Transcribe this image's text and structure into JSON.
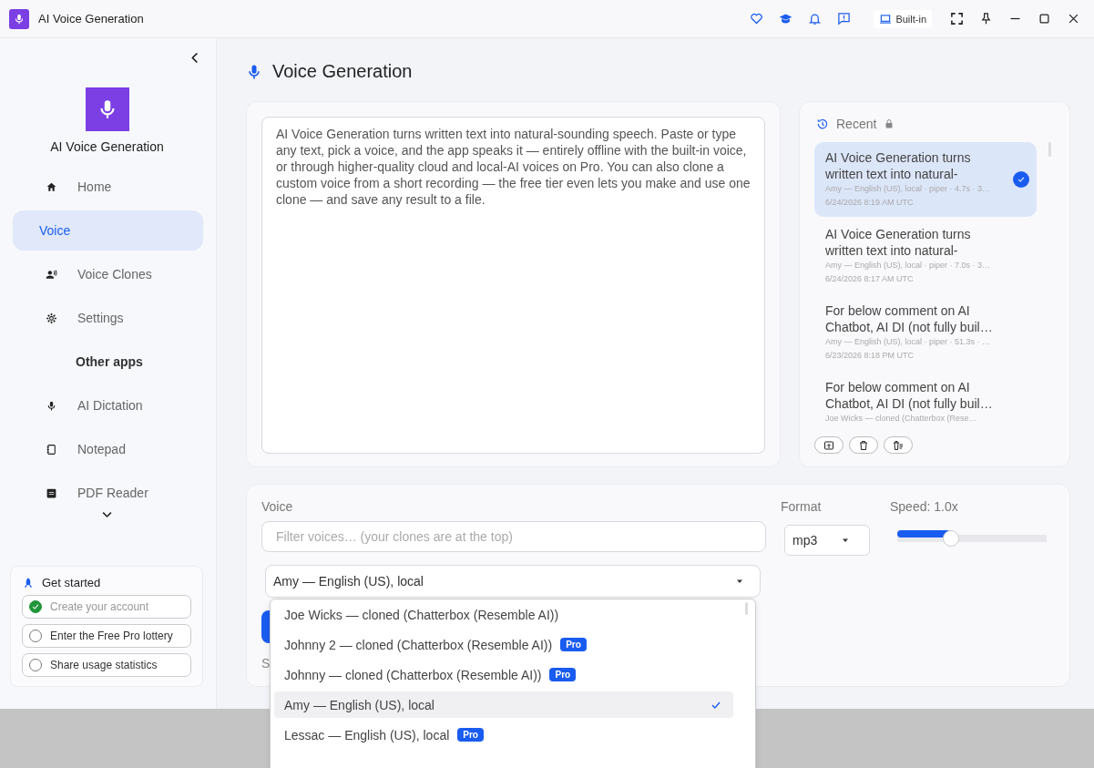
{
  "window": {
    "title": "AI Voice Generation",
    "badge": "Built-in"
  },
  "sidebar": {
    "app_name": "AI Voice Generation",
    "items": [
      {
        "kind": "item",
        "label": "Home",
        "selected": false
      },
      {
        "kind": "item",
        "label": "Voice",
        "selected": true
      },
      {
        "kind": "item",
        "label": "Voice Clones",
        "selected": false
      },
      {
        "kind": "item",
        "label": "Settings",
        "selected": false
      },
      {
        "kind": "header",
        "label": "Other apps"
      },
      {
        "kind": "item",
        "label": "AI Dictation",
        "selected": false
      },
      {
        "kind": "item",
        "label": "Notepad",
        "selected": false
      },
      {
        "kind": "item",
        "label": "PDF Reader",
        "selected": false
      }
    ],
    "get_started": {
      "title": "Get started",
      "tasks": [
        {
          "label": "Create your account",
          "checked": true
        },
        {
          "label": "Enter the Free Pro lottery",
          "checked": false
        },
        {
          "label": "Share usage statistics",
          "checked": false
        }
      ]
    }
  },
  "page": {
    "title": "Voice Generation",
    "text": "AI Voice Generation turns written text into natural-sounding speech. Paste or type any text, pick a voice, and the app speaks it — entirely offline with the built-in voice, or through higher-quality cloud and local-AI voices on Pro. You can also clone a custom voice from a short recording — the free tier even lets you make and use one clone — and save any result to a file.",
    "recent": {
      "title": "Recent",
      "items": [
        {
          "title": "AI Voice Generation turns written text into natural-",
          "meta": "Amy — English (US), local · piper · 4.7s · 3…",
          "date": "6/24/2026 8:19 AM UTC",
          "selected": true
        },
        {
          "title": "AI Voice Generation turns written text into natural-",
          "meta": "Amy — English (US), local · piper · 7.0s · 3…",
          "date": "6/24/2026 8:17 AM UTC",
          "selected": false
        },
        {
          "title": "For below comment on AI Chatbot, AI DI (not fully buil…",
          "meta": "Amy — English (US), local · piper · 51.3s · …",
          "date": "6/23/2026 8:18 PM UTC",
          "selected": false
        },
        {
          "title": "For below comment on AI Chatbot, AI DI (not fully buil…",
          "meta": "Joe Wicks — cloned (Chatterbox (Rese…",
          "selected": false
        }
      ]
    },
    "voice": {
      "label": "Voice",
      "filter_placeholder": "Filter voices… (your clones are at the top)",
      "value": "Amy — English (US), local",
      "options": [
        {
          "label": "Joe Wicks — cloned (Chatterbox (Resemble AI))",
          "selected": false
        },
        {
          "label": "Johnny 2 — cloned (Chatterbox (Resemble AI))",
          "badge": "Pro",
          "selected": false
        },
        {
          "label": "Johnny — cloned (Chatterbox (Resemble AI))",
          "badge": "Pro",
          "selected": false
        },
        {
          "label": "Amy — English (US), local",
          "selected": true
        },
        {
          "label": "Lessac — English (US), local",
          "badge": "Pro",
          "selected": false
        }
      ]
    },
    "format": {
      "label": "Format",
      "value": "mp3"
    },
    "speed": {
      "label": "Speed: 1.0x",
      "level": 0.36
    },
    "status": "S"
  }
}
